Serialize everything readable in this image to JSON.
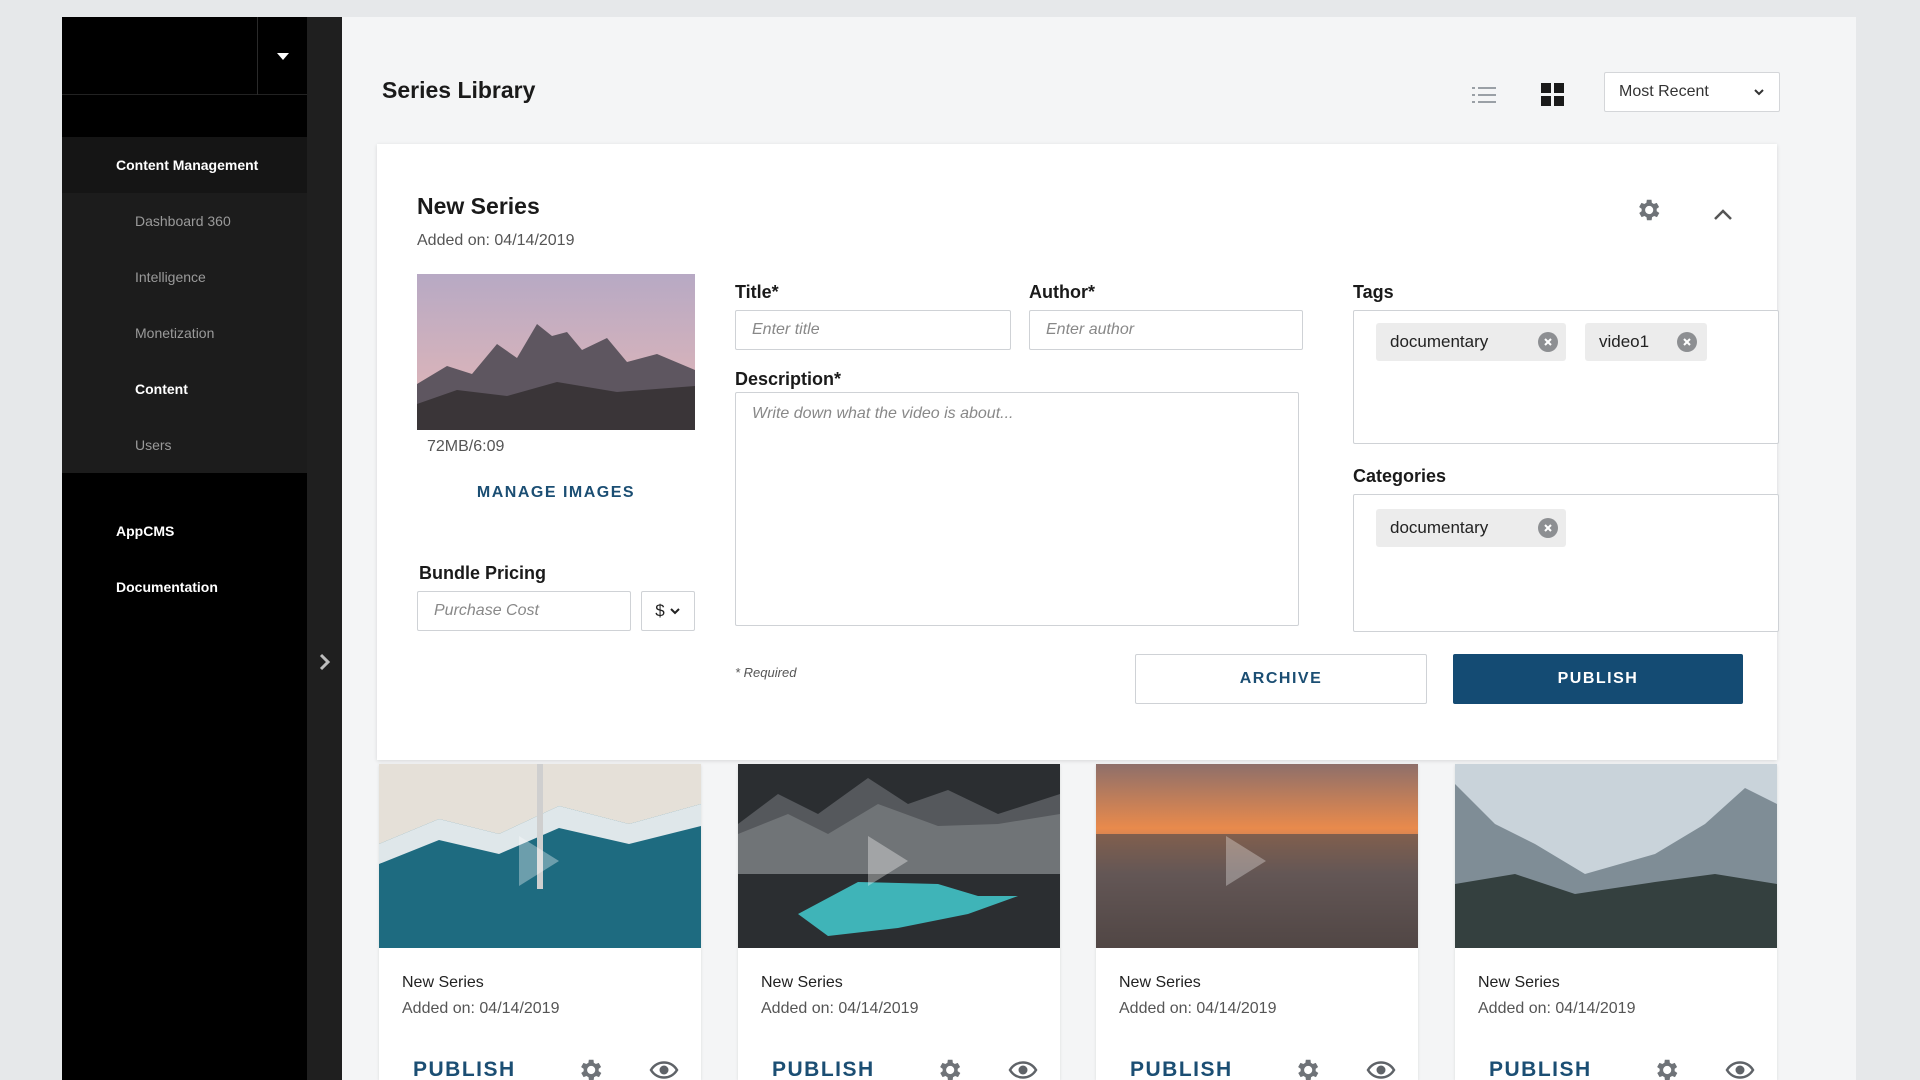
{
  "sidebar": {
    "section_content_management": "Content Management",
    "items": [
      {
        "label": "Dashboard 360"
      },
      {
        "label": "Intelligence"
      },
      {
        "label": "Monetization"
      },
      {
        "label": "Content"
      },
      {
        "label": "Users"
      }
    ],
    "active_item": "Content",
    "section_appcms": "AppCMS",
    "section_documentation": "Documentation"
  },
  "header": {
    "title": "Series Library",
    "sort": {
      "selected": "Most Recent"
    },
    "view_mode": "grid"
  },
  "editor": {
    "name": "New Series",
    "added": "Added on: 04/14/2019",
    "file_meta": "72MB/6:09",
    "manage_images": "MANAGE IMAGES",
    "title_label": "Title*",
    "title_placeholder": "Enter title",
    "author_label": "Author*",
    "author_placeholder": "Enter author",
    "description_label": "Description*",
    "description_placeholder": "Write down what the video is about...",
    "tags_label": "Tags",
    "tags": [
      "documentary",
      "video1"
    ],
    "categories_label": "Categories",
    "categories": [
      "documentary"
    ],
    "bundle_label": "Bundle Pricing",
    "purchase_placeholder": "Purchase Cost",
    "currency": "$",
    "required_note": "* Required",
    "archive": "ARCHIVE",
    "publish": "PUBLISH"
  },
  "grid": [
    {
      "title": "New Series",
      "added": "Added on: 04/14/2019",
      "action": "PUBLISH"
    },
    {
      "title": "New Series",
      "added": "Added on: 04/14/2019",
      "action": "PUBLISH"
    },
    {
      "title": "New Series",
      "added": "Added on: 04/14/2019",
      "action": "PUBLISH"
    },
    {
      "title": "New Series",
      "added": "Added on: 04/14/2019",
      "action": "PUBLISH"
    }
  ],
  "colors": {
    "accent": "#144b73",
    "link": "#1b4e73",
    "sidebar_bg": "#000000"
  }
}
